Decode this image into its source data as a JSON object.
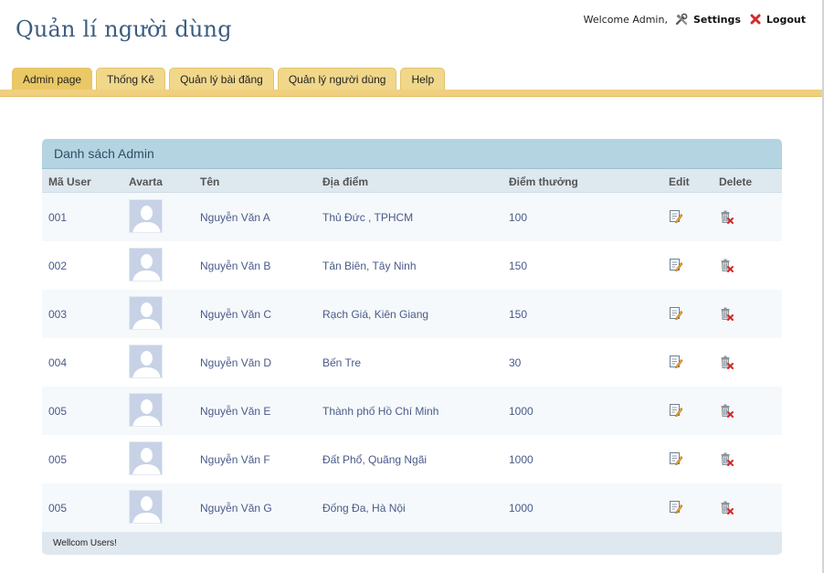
{
  "header": {
    "title": "Quản lí người dùng",
    "welcome": "Welcome Admin,",
    "settings_label": "Settings",
    "logout_label": "Logout"
  },
  "nav": {
    "tabs": [
      {
        "label": "Admin page",
        "active": true
      },
      {
        "label": "Thống Kê",
        "active": false
      },
      {
        "label": "Quản lý bài đăng",
        "active": false
      },
      {
        "label": "Quản lý người dùng",
        "active": false
      },
      {
        "label": "Help",
        "active": false
      }
    ]
  },
  "panel": {
    "title": "Danh sách Admin",
    "columns": {
      "id": "Mã User",
      "avatar": "Avarta",
      "name": "Tên",
      "place": "Địa điểm",
      "points": "Điểm thưởng",
      "edit": "Edit",
      "delete": "Delete"
    },
    "rows": [
      {
        "id": "001",
        "name": "Nguyễn Văn A",
        "place": "Thủ Đức , TPHCM",
        "points": "100"
      },
      {
        "id": "002",
        "name": "Nguyễn Văn B",
        "place": "Tân Biên, Tây Ninh",
        "points": "150"
      },
      {
        "id": "003",
        "name": "Nguyễn Văn C",
        "place": "Rạch Giá, Kiên Giang",
        "points": "150"
      },
      {
        "id": "004",
        "name": "Nguyễn Văn D",
        "place": "Bến Tre",
        "points": "30"
      },
      {
        "id": "005",
        "name": "Nguyễn Văn E",
        "place": "Thành phố Hồ Chí Minh",
        "points": "1000"
      },
      {
        "id": "005",
        "name": "Nguyễn Văn F",
        "place": "Đất Phổ, Quãng Ngãi",
        "points": "1000"
      },
      {
        "id": "005",
        "name": "Nguyễn Văn G",
        "place": "Đống Đa, Hà Nội",
        "points": "1000"
      }
    ],
    "footer": "Wellcom Users!"
  },
  "icons": {
    "settings": "tools-icon",
    "logout": "close-x-icon",
    "edit": "edit-icon",
    "delete": "trash-delete-icon",
    "avatar": "user-silhouette-icon"
  },
  "colors": {
    "tab": "#f0d78a",
    "panel_header": "#b4d4e1",
    "title": "#3b5e80",
    "link_text": "#4a5a8a"
  }
}
